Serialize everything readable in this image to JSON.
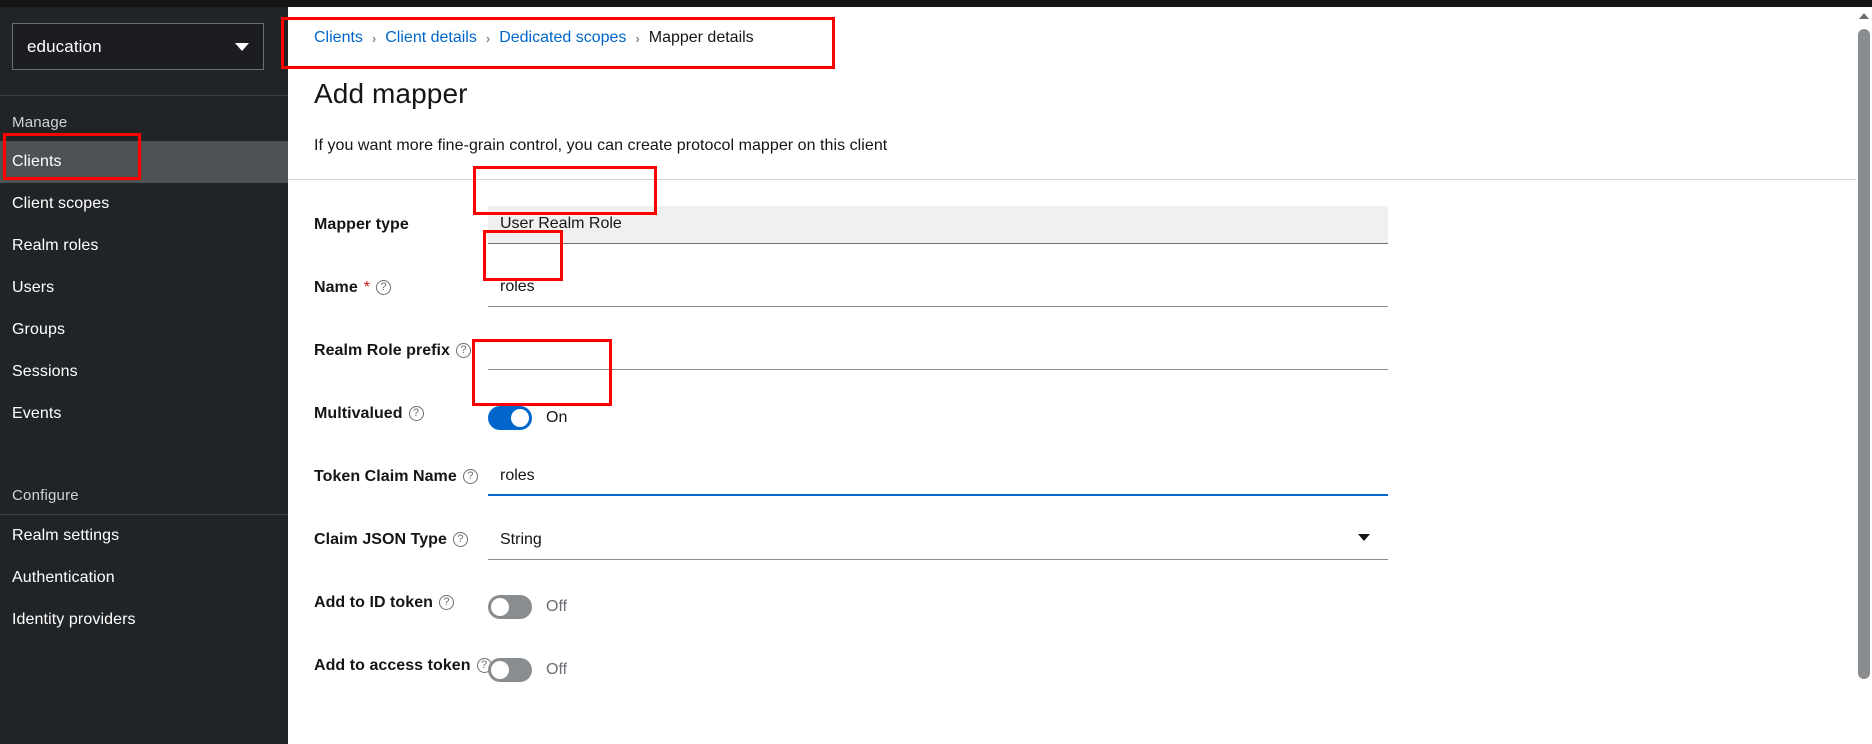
{
  "app": {
    "accent_color": "#0066cc",
    "highlight_color": "#ff0000",
    "sidebar_bg": "#212427"
  },
  "sidebar": {
    "realm_select": {
      "value": "education",
      "caret_icon": "chevron-down-icon"
    },
    "groups": [
      {
        "title": "Manage",
        "items": [
          {
            "label": "Clients",
            "active": true
          },
          {
            "label": "Client scopes",
            "active": false
          },
          {
            "label": "Realm roles",
            "active": false
          },
          {
            "label": "Users",
            "active": false
          },
          {
            "label": "Groups",
            "active": false
          },
          {
            "label": "Sessions",
            "active": false
          },
          {
            "label": "Events",
            "active": false
          }
        ]
      },
      {
        "title": "Configure",
        "items": [
          {
            "label": "Realm settings",
            "active": false
          },
          {
            "label": "Authentication",
            "active": false
          },
          {
            "label": "Identity providers",
            "active": false
          }
        ]
      }
    ]
  },
  "breadcrumb": {
    "items": [
      {
        "label": "Clients",
        "link": true
      },
      {
        "label": "Client details",
        "link": true
      },
      {
        "label": "Dedicated scopes",
        "link": true
      },
      {
        "label": "Mapper details",
        "link": false
      }
    ],
    "separator": "›"
  },
  "page": {
    "title": "Add mapper",
    "subtitle": "If you want more fine-grain control, you can create protocol mapper on this client"
  },
  "form": {
    "mapper_type": {
      "label": "Mapper type",
      "value": "User Realm Role",
      "readonly": true
    },
    "name": {
      "label": "Name",
      "required_marker": "*",
      "help_icon": "help-circle-icon",
      "value": "roles",
      "placeholder": ""
    },
    "realm_role_prefix": {
      "label": "Realm Role prefix",
      "help_icon": "help-circle-icon",
      "value": "",
      "placeholder": ""
    },
    "multivalued": {
      "label": "Multivalued",
      "help_icon": "help-circle-icon",
      "state": "On",
      "on": true
    },
    "token_claim_name": {
      "label": "Token Claim Name",
      "help_icon": "help-circle-icon",
      "value": "roles",
      "placeholder": "",
      "focused": true
    },
    "claim_json_type": {
      "label": "Claim JSON Type",
      "help_icon": "help-circle-icon",
      "value": "String",
      "caret_icon": "chevron-down-icon"
    },
    "add_to_id_token": {
      "label": "Add to ID token",
      "help_icon": "help-circle-icon",
      "state": "Off",
      "on": false
    },
    "add_to_access_token": {
      "label": "Add to access token",
      "help_icon": "help-circle-icon",
      "state": "Off",
      "on": false
    }
  },
  "scrollbar": {
    "up_arrow_icon": "caret-up-icon"
  }
}
